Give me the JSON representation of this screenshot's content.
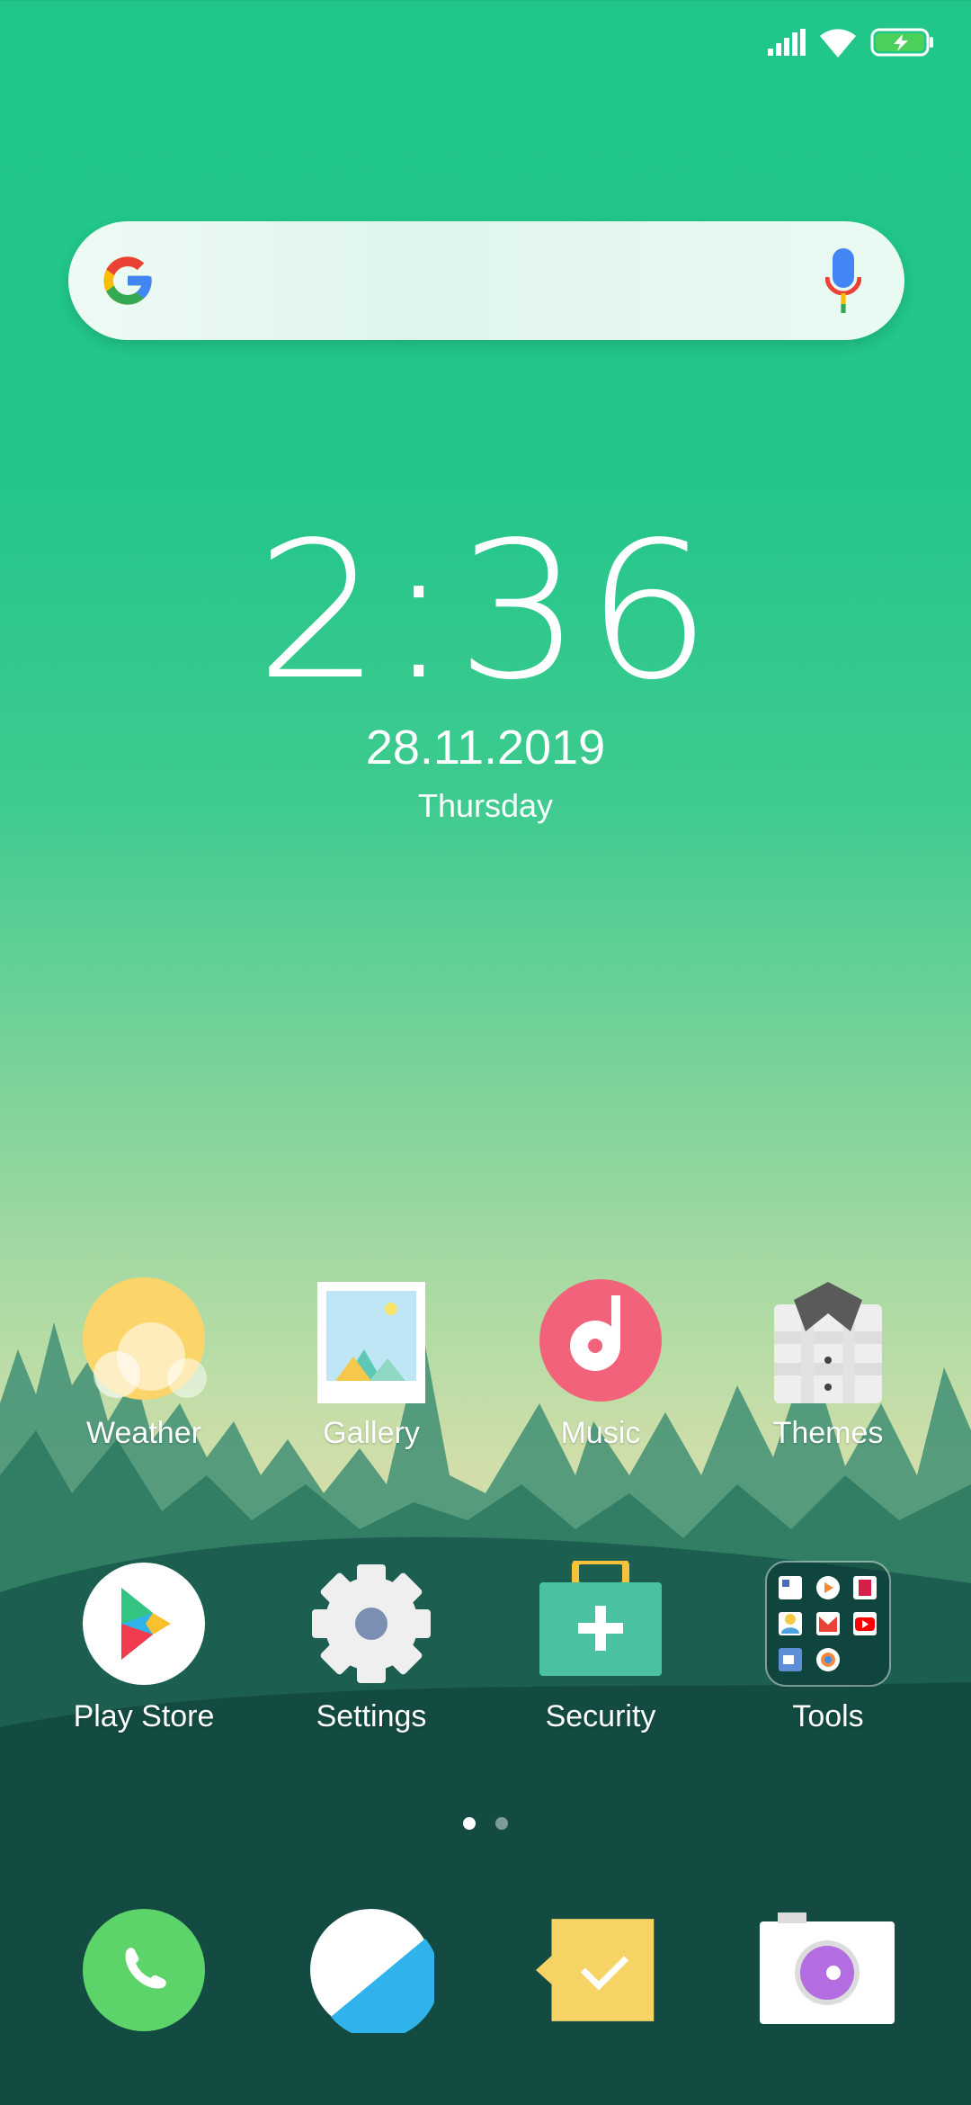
{
  "status_bar": {
    "icons": [
      "signal-icon",
      "wifi-icon",
      "battery-charging-icon"
    ]
  },
  "search": {
    "mic_icon": "mic-icon",
    "logo": "google-logo"
  },
  "clock": {
    "time": "2:36",
    "date": "28.11.2019",
    "day": "Thursday"
  },
  "apps": [
    {
      "label": "Weather"
    },
    {
      "label": "Gallery"
    },
    {
      "label": "Music"
    },
    {
      "label": "Themes"
    },
    {
      "label": "Play Store"
    },
    {
      "label": "Settings"
    },
    {
      "label": "Security"
    },
    {
      "label": "Tools"
    }
  ],
  "pages": {
    "count": 2,
    "current": 1
  },
  "dock": [
    "phone-icon",
    "browser-icon",
    "messages-icon",
    "camera-icon"
  ]
}
